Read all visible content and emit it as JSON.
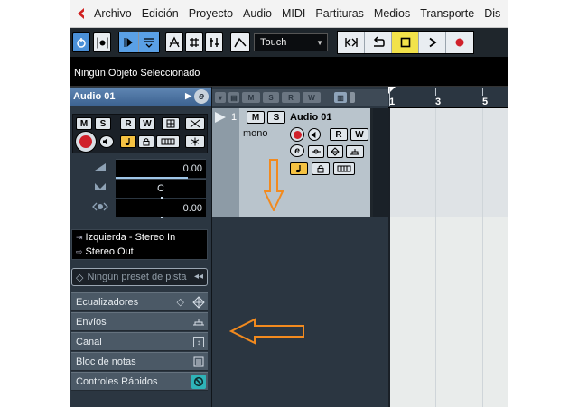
{
  "menubar": {
    "items": [
      "Archivo",
      "Edición",
      "Proyecto",
      "Audio",
      "MIDI",
      "Partituras",
      "Medios",
      "Transporte",
      "Dis"
    ]
  },
  "toolbar": {
    "automation_mode": "Touch"
  },
  "infoline": {
    "text": "Ningún Objeto Seleccionado"
  },
  "inspector": {
    "track_name": "Audio 01",
    "volume": "0.00",
    "pan": "C",
    "delay": "0.00",
    "input_routing": "Izquierda - Stereo In",
    "output_routing": "Stereo Out",
    "preset_placeholder": "Ningún preset de pista",
    "sections": [
      "Ecualizadores",
      "Envíos",
      "Canal",
      "Bloc de notas",
      "Controles Rápidos"
    ]
  },
  "track": {
    "number": "1",
    "name": "Audio 01",
    "channel_config": "mono"
  },
  "ruler": {
    "marks": [
      "1",
      "3",
      "5"
    ]
  },
  "colors": {
    "accent_blue": "#4a90d8",
    "record_red": "#d0202a",
    "stop_yellow": "#f2e24a",
    "annotation_orange": "#f28a1e",
    "quick_controls_teal": "#2fb3b8"
  }
}
